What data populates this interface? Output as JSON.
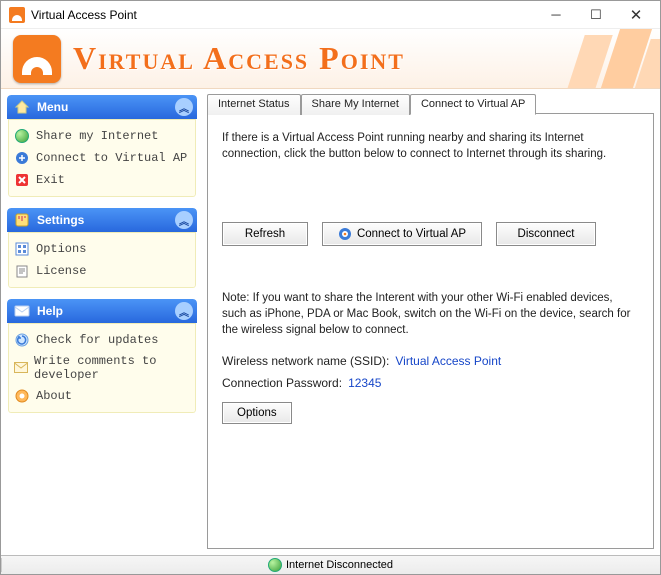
{
  "window": {
    "title": "Virtual Access Point"
  },
  "banner": {
    "title": "Virtual Access Point"
  },
  "sidebar": {
    "panels": [
      {
        "title": "Menu",
        "items": [
          {
            "label": "Share my Internet"
          },
          {
            "label": "Connect to Virtual AP"
          },
          {
            "label": "Exit"
          }
        ]
      },
      {
        "title": "Settings",
        "items": [
          {
            "label": "Options"
          },
          {
            "label": "License"
          }
        ]
      },
      {
        "title": "Help",
        "items": [
          {
            "label": "Check for updates"
          },
          {
            "label": "Write comments to developer"
          },
          {
            "label": "About"
          }
        ]
      }
    ]
  },
  "tabs": [
    {
      "label": "Internet Status"
    },
    {
      "label": "Share My Internet"
    },
    {
      "label": "Connect to Virtual AP",
      "active": true
    }
  ],
  "page": {
    "instruction": "If there is a Virtual Access Point running nearby and sharing its Internet connection, click the button below to connect to Internet through its sharing.",
    "buttons": {
      "refresh": "Refresh",
      "connect": "Connect to Virtual AP",
      "disconnect": "Disconnect"
    },
    "note": "Note: If you want to share the Interent with your other Wi-Fi enabled devices, such as iPhone, PDA or Mac Book, switch on the Wi-Fi on the device, search for the wireless signal below to connect.",
    "ssid_label": "Wireless network name (SSID):",
    "ssid_value": "Virtual Access Point",
    "pwd_label": "Connection Password:",
    "pwd_value": "12345",
    "options_btn": "Options"
  },
  "status": {
    "text": "Internet Disconnected"
  }
}
